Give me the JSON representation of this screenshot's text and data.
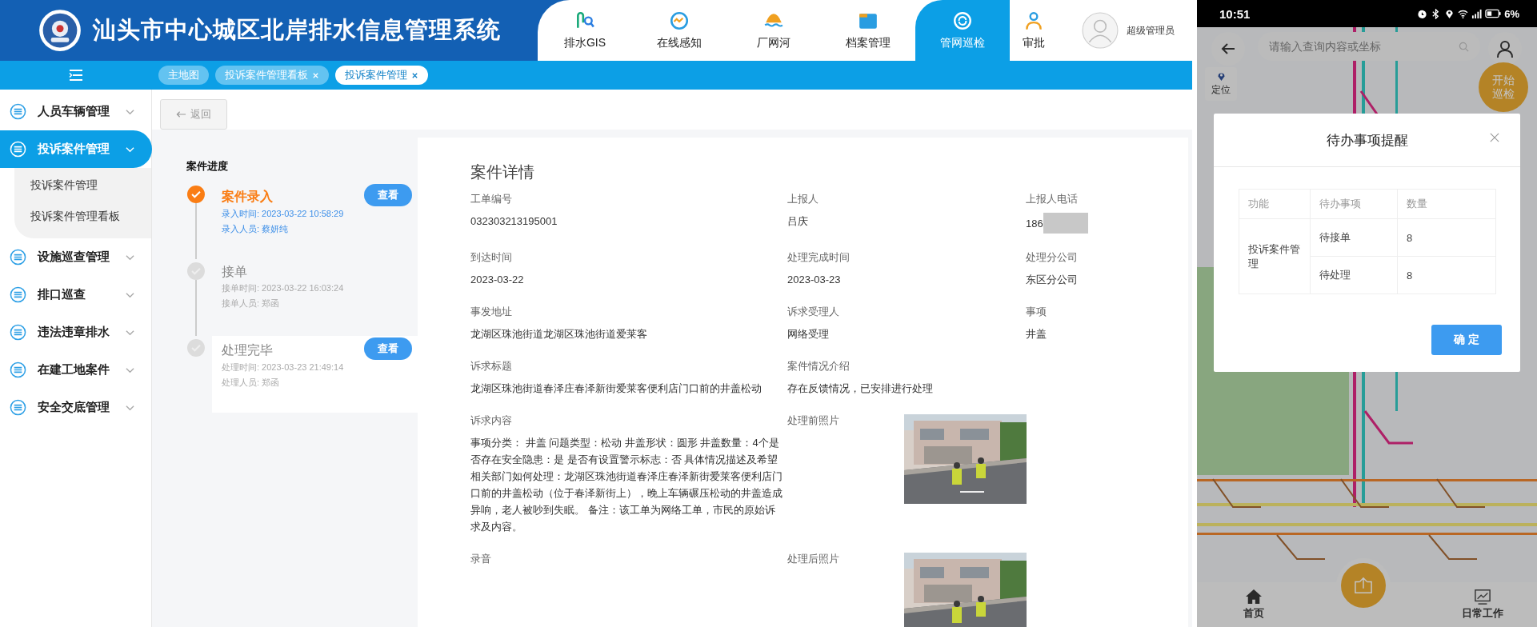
{
  "header": {
    "title": "汕头市中心城区北岸排水信息管理系统",
    "nav": [
      {
        "label": "排水GIS",
        "selected": false
      },
      {
        "label": "在线感知",
        "selected": false
      },
      {
        "label": "厂网河",
        "selected": false
      },
      {
        "label": "档案管理",
        "selected": false
      },
      {
        "label": "管网巡检",
        "selected": true
      },
      {
        "label": "审批",
        "selected": false
      }
    ],
    "user": "超级管理员"
  },
  "tabs": [
    {
      "label": "主地图",
      "selected": false,
      "closable": false
    },
    {
      "label": "投诉案件管理看板",
      "selected": false,
      "closable": true
    },
    {
      "label": "投诉案件管理",
      "selected": true,
      "closable": true
    }
  ],
  "sidebar": [
    {
      "label": "人员车辆管理",
      "selected": false
    },
    {
      "label": "投诉案件管理",
      "selected": true,
      "children": [
        {
          "label": "投诉案件管理"
        },
        {
          "label": "投诉案件管理看板"
        }
      ]
    },
    {
      "label": "设施巡查管理",
      "selected": false
    },
    {
      "label": "排口巡查",
      "selected": false
    },
    {
      "label": "违法违章排水",
      "selected": false
    },
    {
      "label": "在建工地案件",
      "selected": false
    },
    {
      "label": "安全交底管理",
      "selected": false
    }
  ],
  "back_button": "返回",
  "progress": {
    "title": "案件进度",
    "steps": [
      {
        "title": "案件录入",
        "current": true,
        "highlighted": false,
        "lines": [
          "录入时间: 2023-03-22 10:58:29",
          "录入人员: 蔡妍纯"
        ],
        "action": "查看"
      },
      {
        "title": "接单",
        "current": false,
        "highlighted": false,
        "lines": [
          "接单时间: 2023-03-22 16:03:24",
          "接单人员: 郑函"
        ]
      },
      {
        "title": "处理完毕",
        "current": false,
        "highlighted": true,
        "lines": [
          "处理时间: 2023-03-23 21:49:14",
          "处理人员: 郑函"
        ],
        "action": "查看"
      }
    ]
  },
  "details": {
    "title": "案件详情",
    "fields": [
      {
        "label": "工单编号",
        "value": "032303213195001",
        "kind": "text"
      },
      {
        "label": "上报人",
        "value": "吕庆",
        "kind": "text"
      },
      {
        "label": "上报人电话",
        "value": "186",
        "kind": "redacted"
      },
      {
        "label": "到达时间",
        "value": "2023-03-22",
        "kind": "text"
      },
      {
        "label": "处理完成时间",
        "value": "2023-03-23",
        "kind": "text"
      },
      {
        "label": "处理分公司",
        "value": "东区分公司",
        "kind": "text"
      },
      {
        "label": "事发地址",
        "value": "龙湖区珠池街道龙湖区珠池街道爱莱客",
        "kind": "text"
      },
      {
        "label": "诉求受理人",
        "value": "网络受理",
        "kind": "text"
      },
      {
        "label": "事项",
        "value": "井盖",
        "kind": "text"
      },
      {
        "label": "诉求标题",
        "value": "龙湖区珠池街道春泽庄春泽新街爱莱客便利店门口前的井盖松动",
        "kind": "text"
      },
      {
        "label": "案件情况介绍",
        "value": "存在反馈情况，已安排进行处理",
        "kind": "wide"
      },
      {
        "label": "诉求内容",
        "value": "事项分类： 井盖 问题类型：松动 井盖形状：圆形 井盖数量：4个是否存在安全隐患：是 是否有设置警示标志：否 具体情况描述及希望相关部门如何处理：龙湖区珠池街道春泽庄春泽新街爱莱客便利店门口前的井盖松动（位于春泽新街上），晚上车辆碾压松动的井盖造成异响，老人被吵到失眠。 备注：该工单为网络工单，市民的原始诉求及内容。",
        "kind": "text"
      },
      {
        "label": "处理前照片"
      },
      {
        "label": "录音",
        "kind": "text"
      },
      {
        "label": "处理后照片"
      }
    ]
  },
  "phone": {
    "time": "10:51",
    "battery": "6%",
    "search_placeholder": "请输入查询内容或坐标",
    "locate_button": "定位",
    "patrol_button": "开始巡检",
    "dialog": {
      "title": "待办事项提醒",
      "columns": [
        "功能",
        "待办事项",
        "数量"
      ],
      "group": "投诉案件管理",
      "rows": [
        {
          "item": "待接单",
          "count": "8"
        },
        {
          "item": "待处理",
          "count": "8"
        }
      ],
      "confirm": "确 定"
    },
    "nav": [
      "首页",
      "日常工作"
    ]
  }
}
